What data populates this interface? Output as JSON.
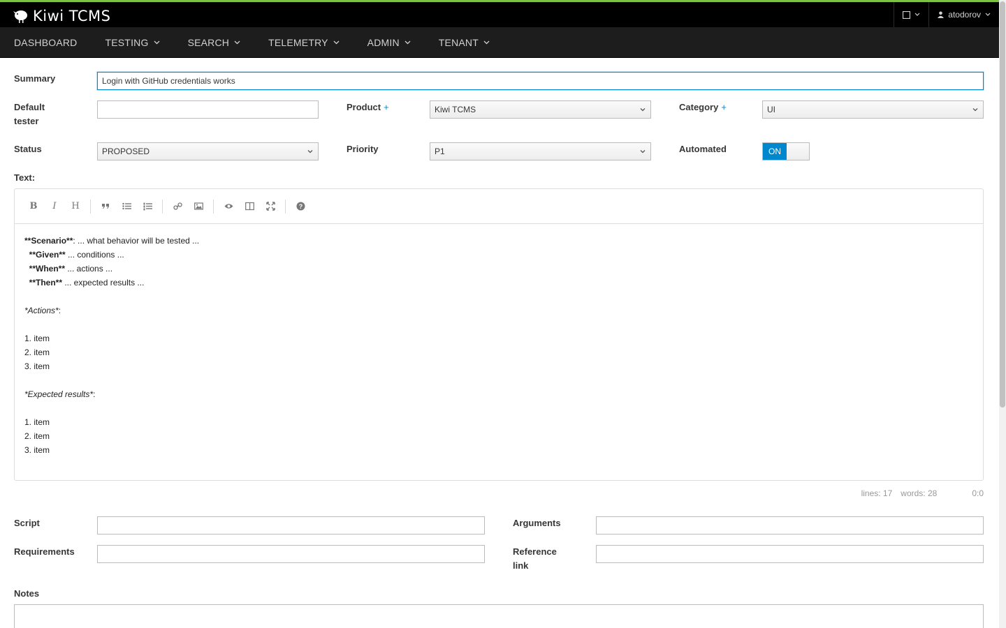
{
  "app": {
    "name": "Kiwi TCMS",
    "user": "atodorov"
  },
  "nav": {
    "items": [
      {
        "label": "DASHBOARD",
        "dropdown": false
      },
      {
        "label": "TESTING",
        "dropdown": true
      },
      {
        "label": "SEARCH",
        "dropdown": true
      },
      {
        "label": "TELEMETRY",
        "dropdown": true
      },
      {
        "label": "ADMIN",
        "dropdown": true
      },
      {
        "label": "TENANT",
        "dropdown": true
      }
    ]
  },
  "form": {
    "summary_label": "Summary",
    "summary_value": "Login with GitHub credentials works",
    "default_tester_label_1": "Default",
    "default_tester_label_2": "tester",
    "default_tester_value": "",
    "product_label": "Product",
    "product_value": "Kiwi TCMS",
    "category_label": "Category",
    "category_value": "UI",
    "status_label": "Status",
    "status_value": "PROPOSED",
    "priority_label": "Priority",
    "priority_value": "P1",
    "automated_label": "Automated",
    "automated_value": "ON",
    "text_label": "Text:",
    "script_label": "Script",
    "arguments_label": "Arguments",
    "requirements_label": "Requirements",
    "reference_link_label_1": "Reference",
    "reference_link_label_2": "link",
    "notes_label": "Notes"
  },
  "editor": {
    "toolbar": [
      "bold",
      "italic",
      "heading",
      "quote",
      "unordered-list",
      "ordered-list",
      "link",
      "image",
      "preview",
      "side-by-side",
      "fullscreen",
      "guide"
    ],
    "lines": [
      {
        "bold": "**Scenario**",
        "rest": ": ... what behavior will be tested ..."
      },
      {
        "bold": "  **Given**",
        "rest": " ... conditions ..."
      },
      {
        "bold": "  **When**",
        "rest": " ... actions ..."
      },
      {
        "bold": "  **Then**",
        "rest": " ... expected results ..."
      },
      {
        "text": ""
      },
      {
        "italic": "*Actions*",
        "rest": ":"
      },
      {
        "text": ""
      },
      {
        "text": "1. item"
      },
      {
        "text": "2. item"
      },
      {
        "text": "3. item"
      },
      {
        "text": ""
      },
      {
        "italic": "*Expected results*",
        "rest": ":"
      },
      {
        "text": ""
      },
      {
        "text": "1. item"
      },
      {
        "text": "2. item"
      },
      {
        "text": "3. item"
      }
    ],
    "status_lines": "lines: 17",
    "status_words": "words: 28",
    "status_cursor": "0:0"
  },
  "colors": {
    "accent": "#0088ce",
    "topbar_border": "#7dc242",
    "topbar_bg": "#000000",
    "navbar_bg": "#1d1d1d"
  }
}
